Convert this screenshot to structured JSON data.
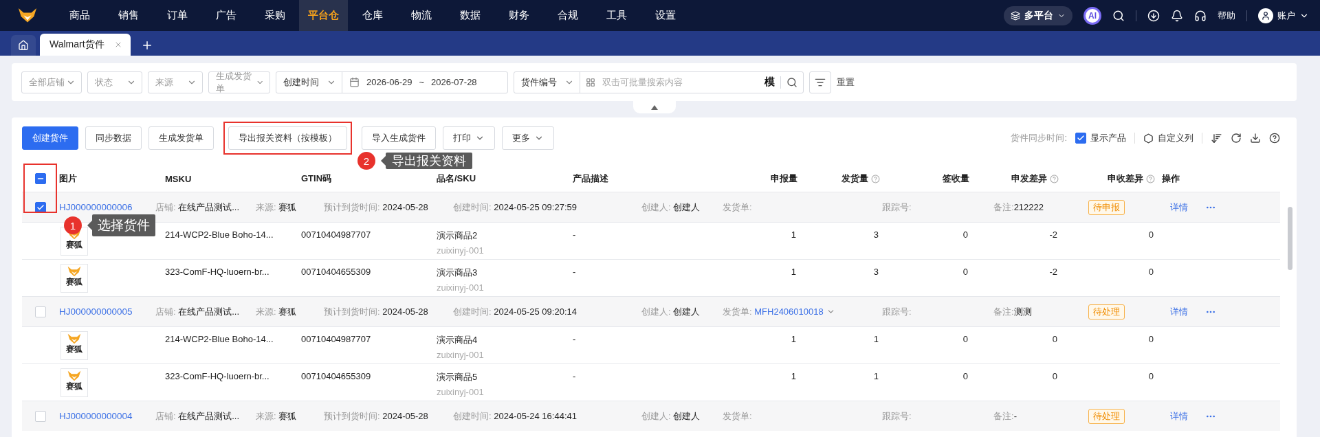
{
  "nav": {
    "items": [
      {
        "label": "商品",
        "selected": false
      },
      {
        "label": "销售",
        "selected": false
      },
      {
        "label": "订单",
        "selected": false
      },
      {
        "label": "广告",
        "selected": false
      },
      {
        "label": "采购",
        "selected": false
      },
      {
        "label": "平台仓",
        "selected": true
      },
      {
        "label": "仓库",
        "selected": false
      },
      {
        "label": "物流",
        "selected": false
      },
      {
        "label": "数据",
        "selected": false
      },
      {
        "label": "财务",
        "selected": false
      },
      {
        "label": "合规",
        "selected": false
      },
      {
        "label": "工具",
        "selected": false
      },
      {
        "label": "设置",
        "selected": false
      }
    ],
    "platform": "多平台",
    "ai": "AI",
    "help": "帮助",
    "account": "账户"
  },
  "tabs": [
    {
      "label": "Walmart货件",
      "selected": true
    }
  ],
  "filters": {
    "selects": [
      "全部店铺",
      "状态",
      "来源",
      "生成发货单"
    ],
    "date_type": "创建时间",
    "date_start": "2026-06-29",
    "date_sep": "~",
    "date_end": "2026-07-28",
    "search_type": "货件编号",
    "search_placeholder": "双击可批量搜索内容",
    "mode": "模",
    "reset": "重置"
  },
  "toolbar": {
    "buttons": [
      {
        "label": "创建货件",
        "kind": "primary",
        "highlighted": false
      },
      {
        "label": "同步数据",
        "kind": "default",
        "highlighted": false
      },
      {
        "label": "生成发货单",
        "kind": "default",
        "highlighted": false
      },
      {
        "label": "导出报关资料（按模板）",
        "kind": "default",
        "highlighted": true
      },
      {
        "label": "导入生成货件",
        "kind": "default",
        "highlighted": false
      },
      {
        "label": "打印",
        "kind": "dropdown",
        "highlighted": false
      },
      {
        "label": "更多",
        "kind": "dropdown",
        "highlighted": false
      }
    ],
    "sync_label": "货件同步时间:",
    "show_products": {
      "label": "显示产品",
      "checked": true
    },
    "custom_columns": "自定义列"
  },
  "table": {
    "select_all_partial": true,
    "select_highlighted": true,
    "columns": [
      {
        "label": "图片",
        "help": false
      },
      {
        "label": "MSKU",
        "help": false
      },
      {
        "label": "GTIN码",
        "help": false
      },
      {
        "label": "品名/SKU",
        "help": false
      },
      {
        "label": "产品描述",
        "help": false
      },
      {
        "label": "申报量",
        "help": false
      },
      {
        "label": "发货量",
        "help": true
      },
      {
        "label": "签收量",
        "help": false
      },
      {
        "label": "申发差异",
        "help": true
      },
      {
        "label": "申收差异",
        "help": true
      },
      {
        "label": "操作",
        "help": false
      }
    ],
    "groups": [
      {
        "selected": true,
        "id": "HJ000000000006",
        "store_label": "店铺:",
        "store": "在线产品测试...",
        "source_label": "来源:",
        "source": "赛狐",
        "eta_label": "预计到货时间:",
        "eta": "2024-05-28",
        "created_label": "创建时间:",
        "created": "2024-05-25 09:27:59",
        "creator_label": "创建人:",
        "creator": "创建人",
        "shipment_label": "发货单:",
        "tracking_label": "跟踪号:",
        "remark_label": "备注:",
        "remark": "212222",
        "status": "待申报",
        "detail": "详情",
        "items": [
          {
            "image_label": "赛狐",
            "msku": "214-WCP2-Blue Boho-14...",
            "gtin": "00710404987707",
            "name": "演示商品2",
            "sku": "zuixinyj-001",
            "desc": "-",
            "declared": "1",
            "shipped": "3",
            "received": "0",
            "diff_ship": "-2",
            "diff_receive": "0"
          },
          {
            "image_label": "赛狐",
            "msku": "323-ComF-HQ-luoern-br...",
            "gtin": "00710404655309",
            "name": "演示商品3",
            "sku": "zuixinyj-001",
            "desc": "-",
            "declared": "1",
            "shipped": "3",
            "received": "0",
            "diff_ship": "-2",
            "diff_receive": "0"
          }
        ]
      },
      {
        "selected": false,
        "id": "HJ000000000005",
        "store_label": "店铺:",
        "store": "在线产品测试...",
        "source_label": "来源:",
        "source": "赛狐",
        "eta_label": "预计到货时间:",
        "eta": "2024-05-28",
        "created_label": "创建时间:",
        "created": "2024-05-25 09:20:14",
        "creator_label": "创建人:",
        "creator": "创建人",
        "shipment_label": "发货单:",
        "shipment": "MFH2406010018",
        "tracking_label": "跟踪号:",
        "remark_label": "备注:",
        "remark": "测测",
        "status": "待处理",
        "detail": "详情",
        "items": [
          {
            "image_label": "赛狐",
            "msku": "214-WCP2-Blue Boho-14...",
            "gtin": "00710404987707",
            "name": "演示商品4",
            "sku": "zuixinyj-001",
            "desc": "-",
            "declared": "1",
            "shipped": "1",
            "received": "0",
            "diff_ship": "0",
            "diff_receive": "0"
          },
          {
            "image_label": "赛狐",
            "msku": "323-ComF-HQ-luoern-br...",
            "gtin": "00710404655309",
            "name": "演示商品5",
            "sku": "zuixinyj-001",
            "desc": "-",
            "declared": "1",
            "shipped": "1",
            "received": "0",
            "diff_ship": "0",
            "diff_receive": "0"
          }
        ]
      },
      {
        "selected": false,
        "id": "HJ000000000004",
        "store_label": "店铺:",
        "store": "在线产品测试...",
        "source_label": "来源:",
        "source": "赛狐",
        "eta_label": "预计到货时间:",
        "eta": "2024-05-28",
        "created_label": "创建时间:",
        "created": "2024-05-24 16:44:41",
        "creator_label": "创建人:",
        "creator": "创建人",
        "shipment_label": "发货单:",
        "tracking_label": "跟踪号:",
        "remark_label": "备注:",
        "remark": "-",
        "status": "待处理",
        "detail": "详情"
      }
    ]
  },
  "callouts": [
    {
      "number": "1",
      "text": "选择货件"
    },
    {
      "number": "2",
      "text": "导出报关资料"
    }
  ]
}
